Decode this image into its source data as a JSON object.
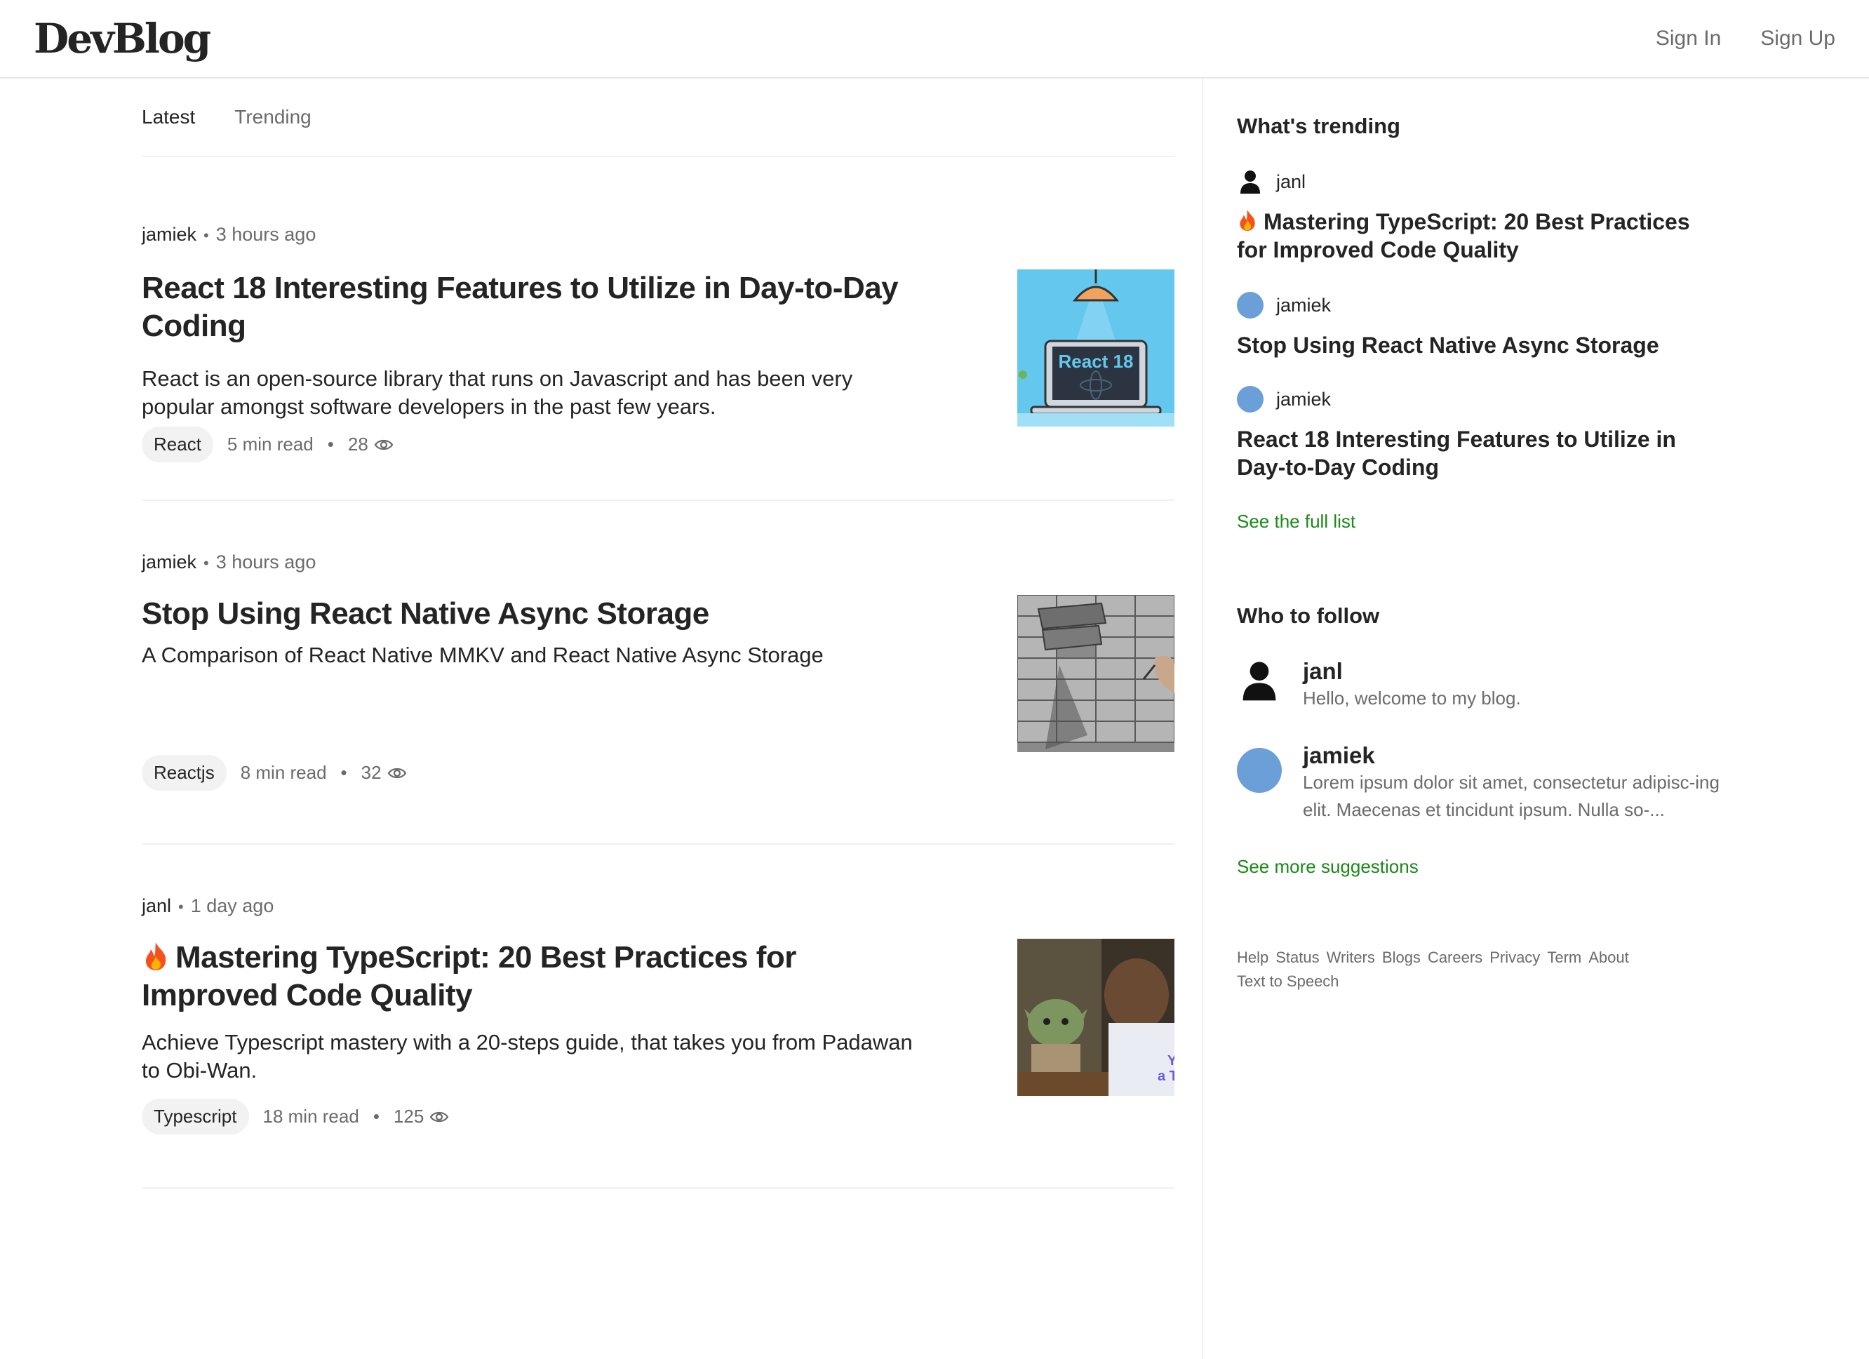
{
  "header": {
    "logo": "DevBlog",
    "sign_in": "Sign In",
    "sign_up": "Sign Up"
  },
  "tabs": [
    "Latest",
    "Trending"
  ],
  "articles": [
    {
      "author": "jamiek",
      "time": "3 hours ago",
      "title": "React 18 Interesting Features to Utilize in Day-to-Day Coding",
      "excerpt": "React is an open-source library that runs on Javascript and has been very popular amongst software developers in the past few years.",
      "tag": "React",
      "read_time": "5 min read",
      "views": "28",
      "thumb_text": "React 18"
    },
    {
      "author": "jamiek",
      "time": "3 hours ago",
      "title": "Stop Using React Native Async Storage",
      "excerpt": "A Comparison of React Native MMKV and React Native Async Storage",
      "tag": "Reactjs",
      "read_time": "8 min read",
      "views": "32"
    },
    {
      "author": "janl",
      "time": "1 day ago",
      "title": "Mastering TypeScript: 20 Best Practices for Improved Code Quality",
      "excerpt": "Achieve Typescript mastery with a 20-steps guide, that takes you from Padawan to Obi-Wan.",
      "tag": "Typescript",
      "read_time": "18 min read",
      "views": "125"
    }
  ],
  "trending": {
    "heading": "What's trending",
    "items": [
      {
        "author": "janl",
        "title": "Mastering TypeScript: 20 Best Practices for Improved Code Quality"
      },
      {
        "author": "jamiek",
        "title": "Stop Using React Native Async Storage"
      },
      {
        "author": "jamiek",
        "title": "React 18 Interesting Features to Utilize in Day-to-Day Coding"
      }
    ],
    "see_full": "See the full list"
  },
  "follow": {
    "heading": "Who to follow",
    "people": [
      {
        "name": "janl",
        "bio": "Hello, welcome to my blog."
      },
      {
        "name": "jamiek",
        "bio": "Lorem ipsum dolor sit amet, consectetur adipisc-ing elit. Maecenas et tincidunt ipsum. Nulla so-..."
      }
    ],
    "see_more": "See more suggestions"
  },
  "footer_links": [
    "Help",
    "Status",
    "Writers",
    "Blogs",
    "Careers",
    "Privacy",
    "Term",
    "About",
    "Text to Speech"
  ],
  "colors": {
    "text": "#242424",
    "muted": "#6b6b6b",
    "link_green": "#1a8917",
    "avatar_blue": "#6a9fd8",
    "fire": "#f4511e"
  }
}
